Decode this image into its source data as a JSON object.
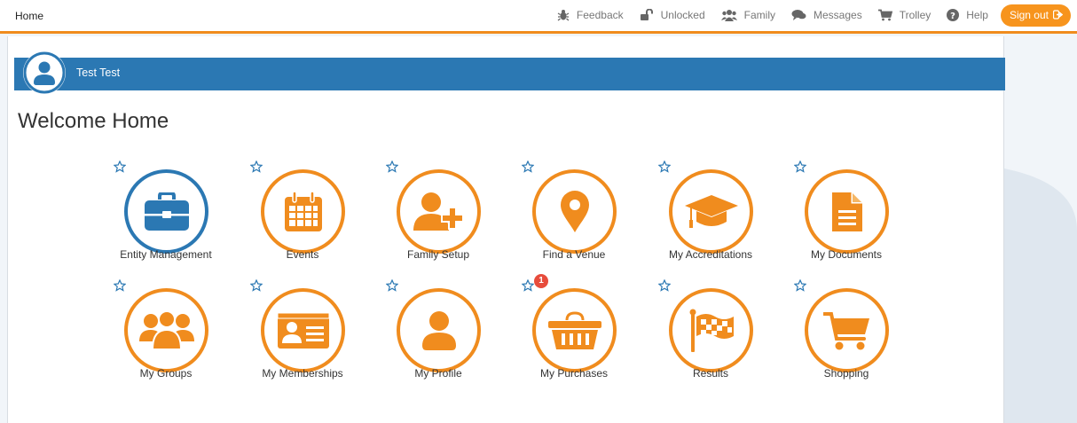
{
  "header": {
    "home_label": "Home",
    "nav": [
      {
        "label": "Feedback",
        "icon": "bug-icon"
      },
      {
        "label": "Unlocked",
        "icon": "unlock-icon"
      },
      {
        "label": "Family",
        "icon": "users-icon"
      },
      {
        "label": "Messages",
        "icon": "comments-icon"
      },
      {
        "label": "Trolley",
        "icon": "cart-icon"
      },
      {
        "label": "Help",
        "icon": "question-circle-icon"
      }
    ],
    "signout_label": "Sign out"
  },
  "user": {
    "name": "Test Test"
  },
  "page_title": "Welcome Home",
  "tiles": [
    {
      "label": "Entity Management",
      "icon": "briefcase-icon"
    },
    {
      "label": "Events",
      "icon": "calendar-icon"
    },
    {
      "label": "Family Setup",
      "icon": "user-plus-icon"
    },
    {
      "label": "Find a Venue",
      "icon": "map-marker-icon"
    },
    {
      "label": "My Accreditations",
      "icon": "graduation-cap-icon"
    },
    {
      "label": "My Documents",
      "icon": "document-icon"
    },
    {
      "label": "My Groups",
      "icon": "group-icon"
    },
    {
      "label": "My Memberships",
      "icon": "id-card-icon"
    },
    {
      "label": "My Profile",
      "icon": "user-icon"
    },
    {
      "label": "My Purchases",
      "icon": "basket-icon",
      "badge": "1"
    },
    {
      "label": "Results",
      "icon": "checkered-flag-icon"
    },
    {
      "label": "Shopping",
      "icon": "shopping-cart-icon"
    }
  ],
  "colors": {
    "accent": "#f08c1e",
    "brand_blue": "#2b78b3",
    "badge_red": "#e74c3c"
  }
}
